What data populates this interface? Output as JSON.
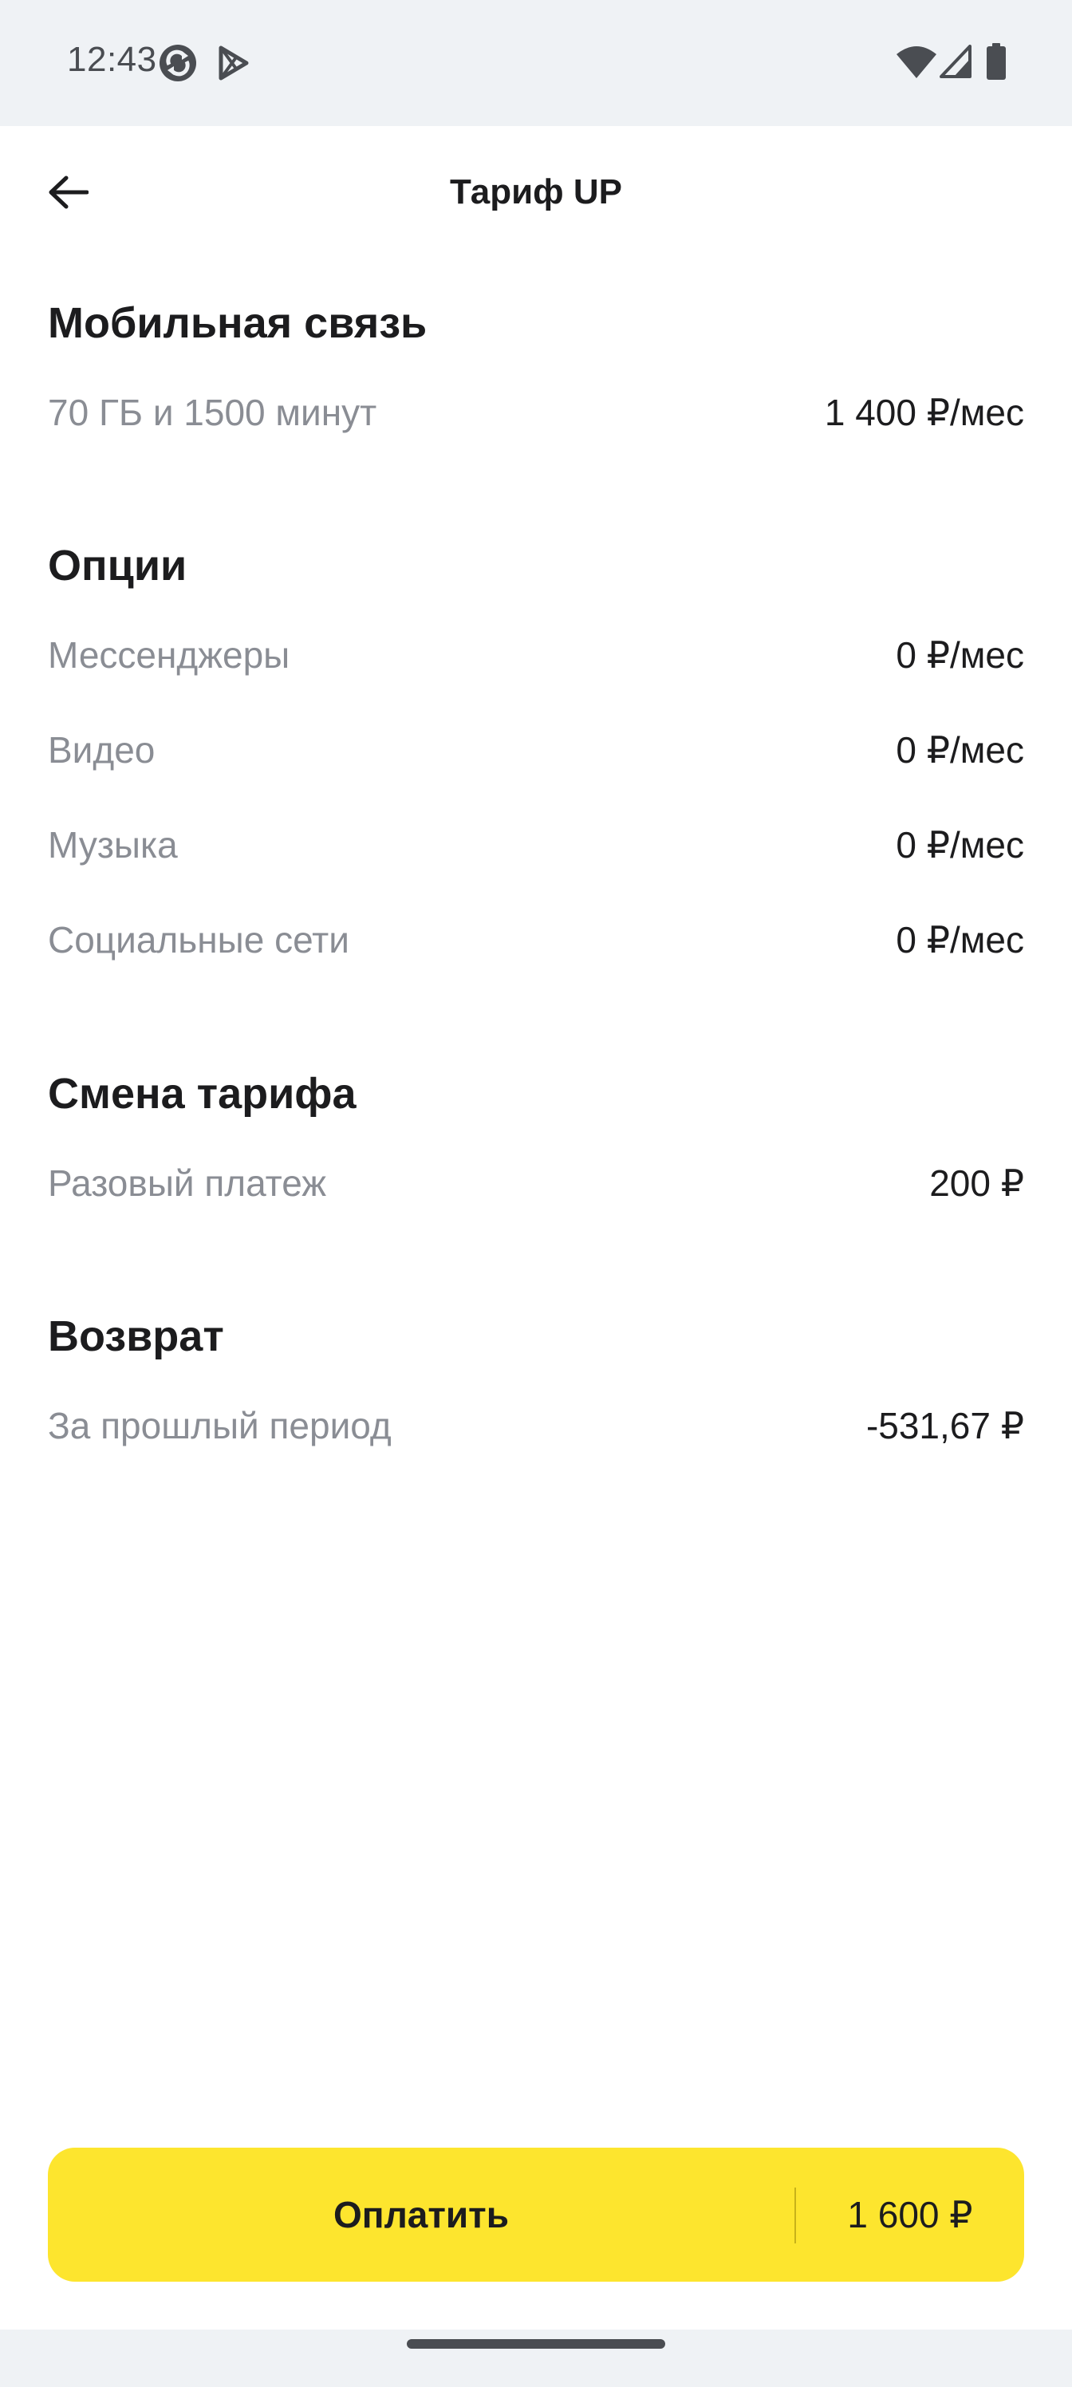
{
  "status_bar": {
    "time": "12:43",
    "icons": [
      "sync-notification-icon",
      "play-store-notification-icon",
      "wifi-icon",
      "cellular-signal-icon",
      "battery-icon"
    ]
  },
  "header": {
    "title": "Тариф UP",
    "back_icon": "arrow-left-icon"
  },
  "sections": {
    "mobile": {
      "title": "Мобильная связь",
      "rows": [
        {
          "label": "70 ГБ и 1500 минут",
          "value": "1 400 ₽/мес"
        }
      ]
    },
    "options": {
      "title": "Опции",
      "rows": [
        {
          "label": "Мессенджеры",
          "value": "0 ₽/мес"
        },
        {
          "label": "Видео",
          "value": "0 ₽/мес"
        },
        {
          "label": "Музыка",
          "value": "0 ₽/мес"
        },
        {
          "label": "Социальные сети",
          "value": "0 ₽/мес"
        }
      ]
    },
    "tariff_change": {
      "title": "Смена тарифа",
      "rows": [
        {
          "label": "Разовый платеж",
          "value": "200 ₽"
        }
      ]
    },
    "refund": {
      "title": "Возврат",
      "rows": [
        {
          "label": "За прошлый период",
          "value": "-531,67 ₽"
        }
      ]
    }
  },
  "pay_button": {
    "label": "Оплатить",
    "amount": "1 600 ₽"
  },
  "colors": {
    "accent": "#fde52e",
    "text_primary": "#1c1c1e",
    "text_secondary": "#8a8d94",
    "system_bar": "#eff2f5"
  }
}
